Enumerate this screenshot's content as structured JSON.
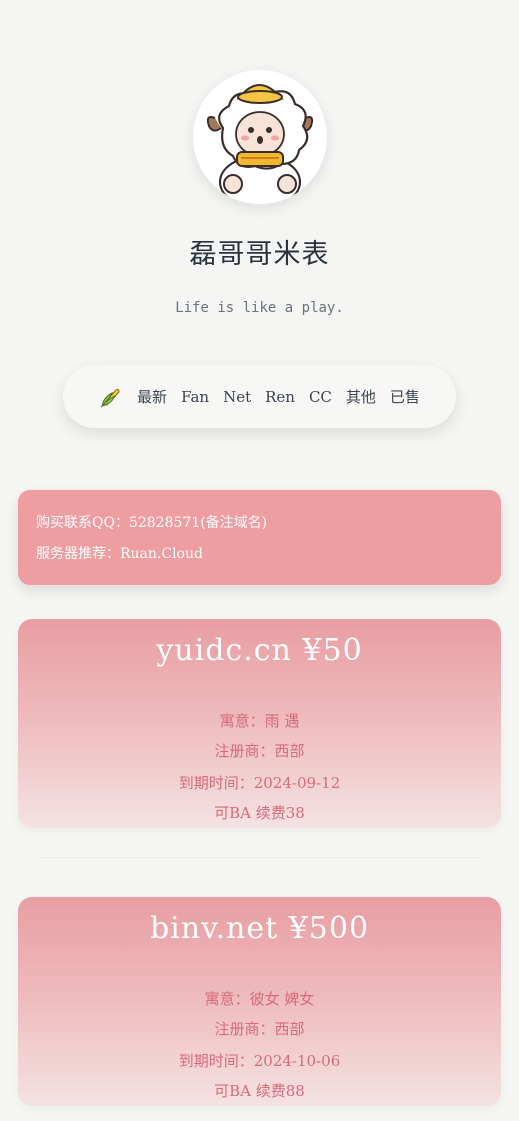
{
  "header": {
    "site_title": "磊哥哥米表",
    "site_desc": "Life is like a play."
  },
  "nav": {
    "logo_icon": "corn-icon",
    "items": [
      {
        "label": "最新"
      },
      {
        "label": "Fan"
      },
      {
        "label": "Net"
      },
      {
        "label": "Ren"
      },
      {
        "label": "CC"
      },
      {
        "label": "其他"
      },
      {
        "label": "已售"
      }
    ]
  },
  "notice": {
    "line1": "购买联系QQ：52828571(备注域名)",
    "line2": "服务器推荐：Ruan.Cloud"
  },
  "cards": [
    {
      "title": "yuidc.cn ¥50",
      "meaning": "寓意：雨 遇",
      "registrar": "注册商：西部",
      "expiry": "到期时间：2024-09-12",
      "renew": "可BA 续费38"
    },
    {
      "title": "binv.net ¥500",
      "meaning": "寓意：彼女 婢女",
      "registrar": "注册商：西部",
      "expiry": "到期时间：2024-10-06",
      "renew": "可BA 续费88"
    }
  ],
  "colors": {
    "background": "#f5f5f3",
    "notice": "#ee9da1",
    "card_top": "#e89ea2",
    "card_text": "#d86a7a"
  }
}
